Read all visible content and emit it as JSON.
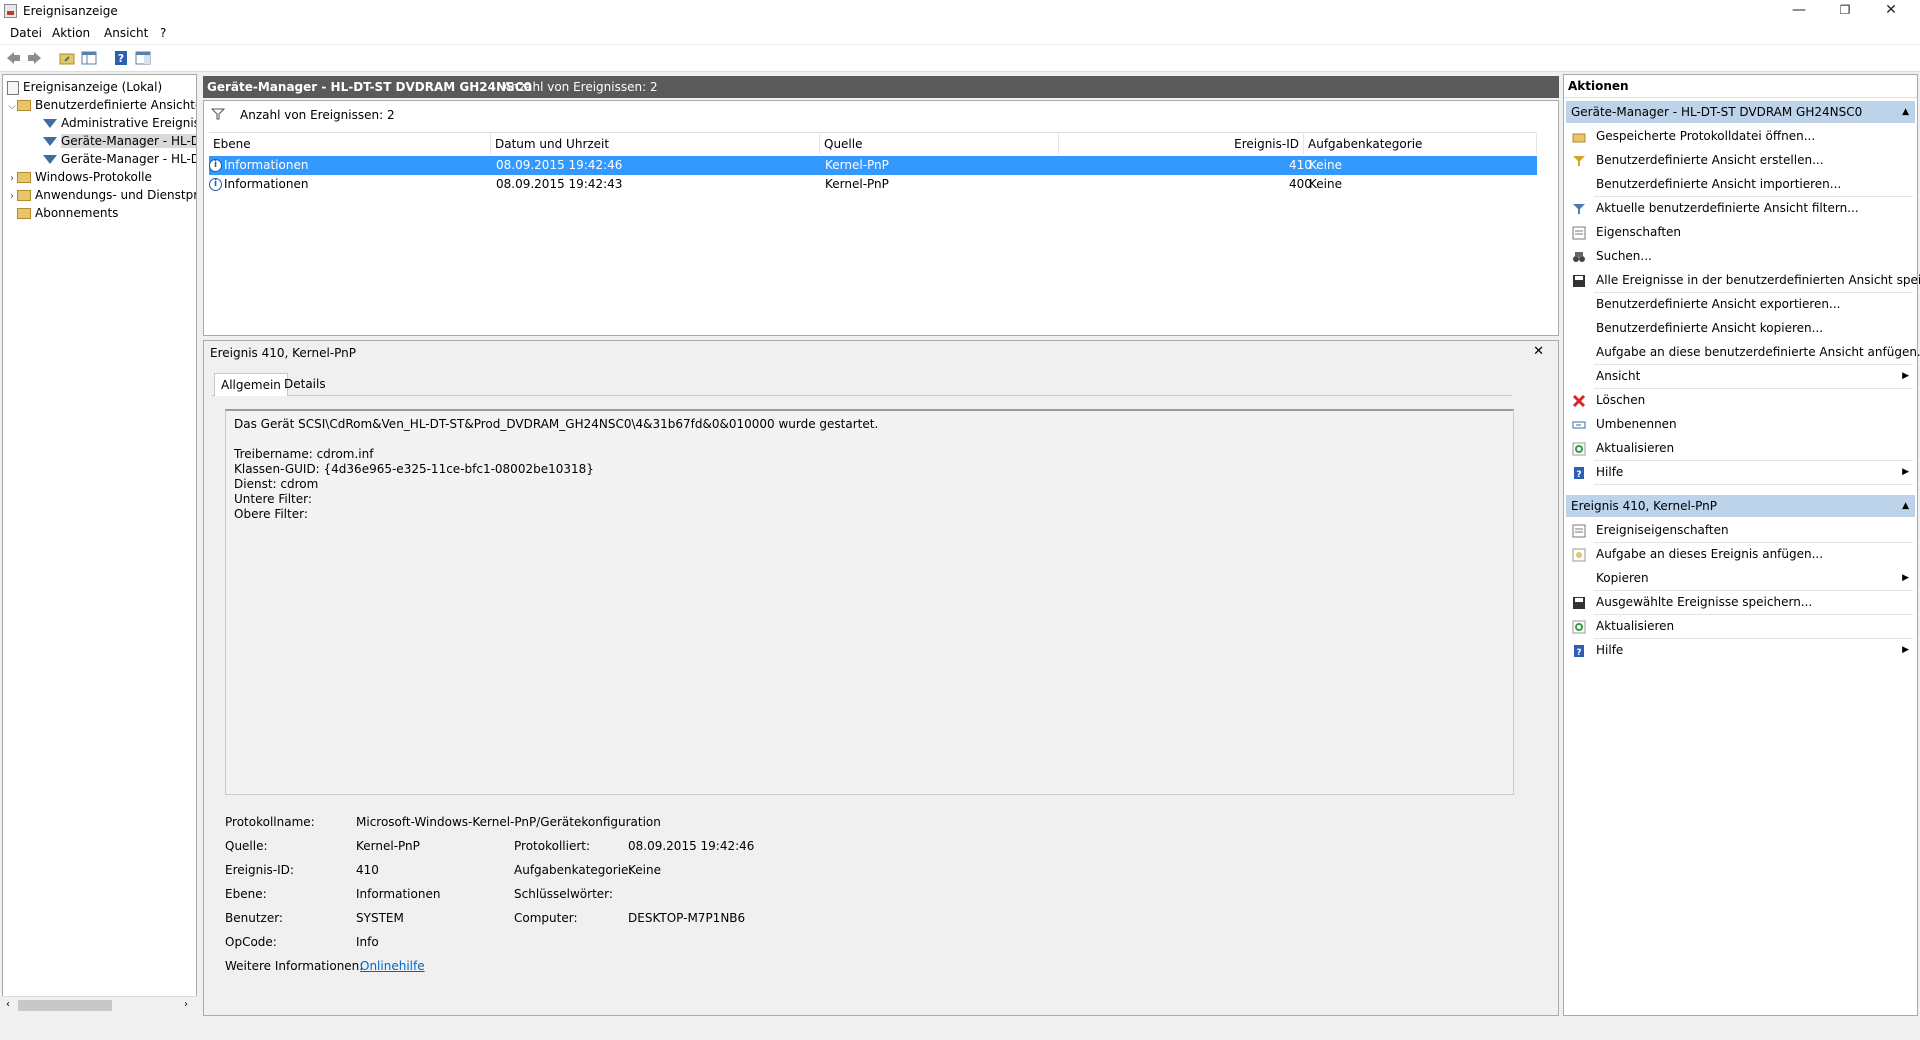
{
  "window": {
    "title": "Ereignisanzeige",
    "minimize": "—",
    "restore": "❐",
    "close": "✕"
  },
  "menu": {
    "items": [
      "Datei",
      "Aktion",
      "Ansicht",
      "?"
    ]
  },
  "tree": {
    "items": [
      {
        "label": "Ereignisanzeige (Lokal)"
      },
      {
        "label": "Benutzerdefinierte Ansichten"
      },
      {
        "label": "Administrative Ereignisse"
      },
      {
        "label": "Geräte-Manager - HL-DT-"
      },
      {
        "label": "Geräte-Manager - HL-DT-"
      },
      {
        "label": "Windows-Protokolle"
      },
      {
        "label": "Anwendungs- und Dienstpro"
      },
      {
        "label": "Abonnements"
      }
    ]
  },
  "center": {
    "title": "Geräte-Manager - HL-DT-ST DVDRAM GH24NSC0",
    "count": "Anzahl von Ereignissen: 2",
    "filter_count": "Anzahl von Ereignissen: 2",
    "columns": [
      "Ebene",
      "Datum und Uhrzeit",
      "Quelle",
      "Ereignis-ID",
      "Aufgabenkategorie"
    ],
    "rows": [
      {
        "level": "Informationen",
        "datetime": "08.09.2015 19:42:46",
        "source": "Kernel-PnP",
        "id": "410",
        "category": "Keine",
        "selected": true
      },
      {
        "level": "Informationen",
        "datetime": "08.09.2015 19:42:43",
        "source": "Kernel-PnP",
        "id": "400",
        "category": "Keine",
        "selected": false
      }
    ]
  },
  "detail": {
    "title": "Ereignis 410, Kernel-PnP",
    "close": "✕",
    "tabs": [
      "Allgemein",
      "Details"
    ],
    "description": [
      "Das Gerät SCSI\\CdRom&Ven_HL-DT-ST&Prod_DVDRAM_GH24NSC0\\4&31b67fd&0&010000 wurde gestartet.",
      "",
      "Treibername: cdrom.inf",
      "Klassen-GUID: {4d36e965-e325-11ce-bfc1-08002be10318}",
      "Dienst: cdrom",
      "Untere Filter:",
      "Obere Filter:"
    ],
    "props": {
      "protokollname_label": "Protokollname:",
      "protokollname": "Microsoft-Windows-Kernel-PnP/Gerätekonfiguration",
      "quelle_label": "Quelle:",
      "quelle": "Kernel-PnP",
      "protokolliert_label": "Protokolliert:",
      "protokolliert": "08.09.2015 19:42:46",
      "id_label": "Ereignis-ID:",
      "id": "410",
      "aufgabe_label": "Aufgabenkategorie:",
      "aufgabe": "Keine",
      "ebene_label": "Ebene:",
      "ebene": "Informationen",
      "schluessel_label": "Schlüsselwörter:",
      "schluessel": "",
      "benutzer_label": "Benutzer:",
      "benutzer": "SYSTEM",
      "computer_label": "Computer:",
      "computer": "DESKTOP-M7P1NB6",
      "opcode_label": "OpCode:",
      "opcode": "Info",
      "weitere_label": "Weitere Informationen:",
      "weitere_link": "Onlinehilfe"
    }
  },
  "actions": {
    "title": "Aktionen",
    "section1": "Geräte-Manager - HL-DT-ST DVDRAM GH24NSC0",
    "items1": [
      {
        "label": "Gespeicherte Protokolldatei öffnen...",
        "icon": "folder-open-icon"
      },
      {
        "label": "Benutzerdefinierte Ansicht erstellen...",
        "icon": "filter-create-icon"
      },
      {
        "label": "Benutzerdefinierte Ansicht importieren...",
        "icon": ""
      },
      {
        "label": "Aktuelle benutzerdefinierte Ansicht filtern...",
        "icon": "filter-icon"
      },
      {
        "label": "Eigenschaften",
        "icon": "properties-icon"
      },
      {
        "label": "Suchen...",
        "icon": "binoculars-icon"
      },
      {
        "label": "Alle Ereignisse in der benutzerdefinierten Ansicht speic...",
        "icon": "save-icon"
      },
      {
        "label": "Benutzerdefinierte Ansicht exportieren...",
        "icon": ""
      },
      {
        "label": "Benutzerdefinierte Ansicht kopieren...",
        "icon": ""
      },
      {
        "label": "Aufgabe an diese benutzerdefinierte Ansicht anfügen...",
        "icon": ""
      },
      {
        "label": "Ansicht",
        "icon": "",
        "submenu": true
      },
      {
        "label": "Löschen",
        "icon": "delete-icon"
      },
      {
        "label": "Umbenennen",
        "icon": "rename-icon"
      },
      {
        "label": "Aktualisieren",
        "icon": "refresh-icon"
      },
      {
        "label": "Hilfe",
        "icon": "help-icon",
        "submenu": true
      }
    ],
    "section2": "Ereignis 410, Kernel-PnP",
    "items2": [
      {
        "label": "Ereigniseigenschaften",
        "icon": "properties-icon"
      },
      {
        "label": "Aufgabe an dieses Ereignis anfügen...",
        "icon": "task-icon"
      },
      {
        "label": "Kopieren",
        "icon": "",
        "submenu": true
      },
      {
        "label": "Ausgewählte Ereignisse speichern...",
        "icon": "save-icon"
      },
      {
        "label": "Aktualisieren",
        "icon": "refresh-icon"
      },
      {
        "label": "Hilfe",
        "icon": "help-icon",
        "submenu": true
      }
    ]
  },
  "colors": {
    "selection": "#3399ff",
    "section_header": "#bdd3ea",
    "center_header": "#5a5a5a",
    "link": "#0066cc"
  }
}
